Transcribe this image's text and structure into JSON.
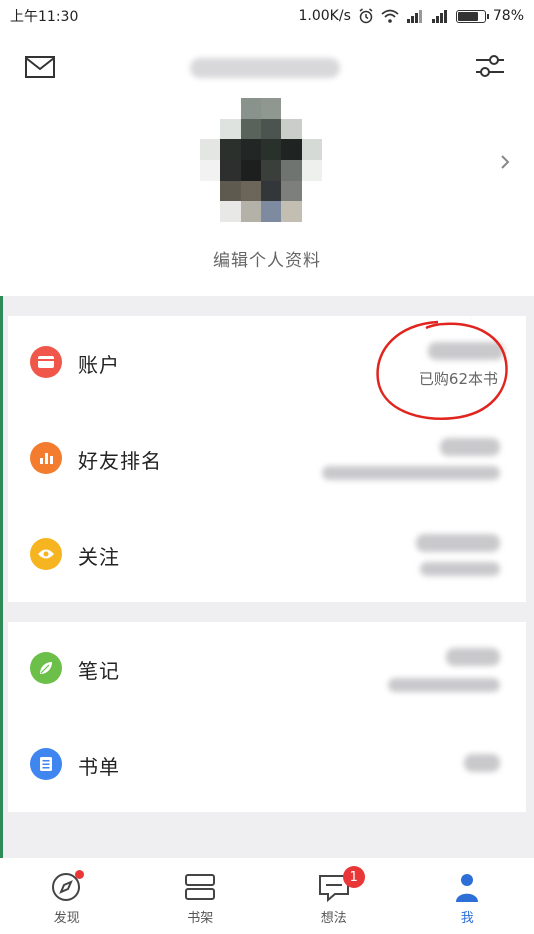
{
  "status_bar": {
    "time": "上午11:30",
    "network_speed": "1.00K/s",
    "battery": "78%",
    "battery_level": 0.78,
    "icons": [
      "alarm-icon",
      "wifi-icon",
      "signal-icon",
      "signal-icon",
      "battery-icon"
    ]
  },
  "profile": {
    "edit_label": "编辑个人资料",
    "icons": [
      "mail-icon",
      "settings-sliders-icon",
      "chevron-right-icon"
    ]
  },
  "menu_group_1": [
    {
      "label": "账户",
      "subtitle": "已购62本书",
      "icon": "wallet-icon",
      "color": "#f0574a"
    },
    {
      "label": "好友排名",
      "subtitle": "",
      "icon": "bar-chart-icon",
      "color": "#f47c2f"
    },
    {
      "label": "关注",
      "subtitle": "",
      "icon": "eye-icon",
      "color": "#f6b520"
    }
  ],
  "menu_group_2": [
    {
      "label": "笔记",
      "subtitle": "",
      "icon": "leaf-icon",
      "color": "#6cc04a"
    },
    {
      "label": "书单",
      "subtitle": "",
      "icon": "list-icon",
      "color": "#3f86f0"
    }
  ],
  "tabbar": {
    "tabs": [
      {
        "label": "发现",
        "icon": "compass-icon"
      },
      {
        "label": "书架",
        "icon": "bookshelf-icon"
      },
      {
        "label": "想法",
        "icon": "chat-bubble-icon",
        "badge": "1"
      },
      {
        "label": "我",
        "icon": "person-icon",
        "active": true
      }
    ]
  },
  "colors": {
    "accent_blue": "#2d6fd6",
    "badge_red": "#e93737",
    "annotation_red": "#e0251f"
  }
}
